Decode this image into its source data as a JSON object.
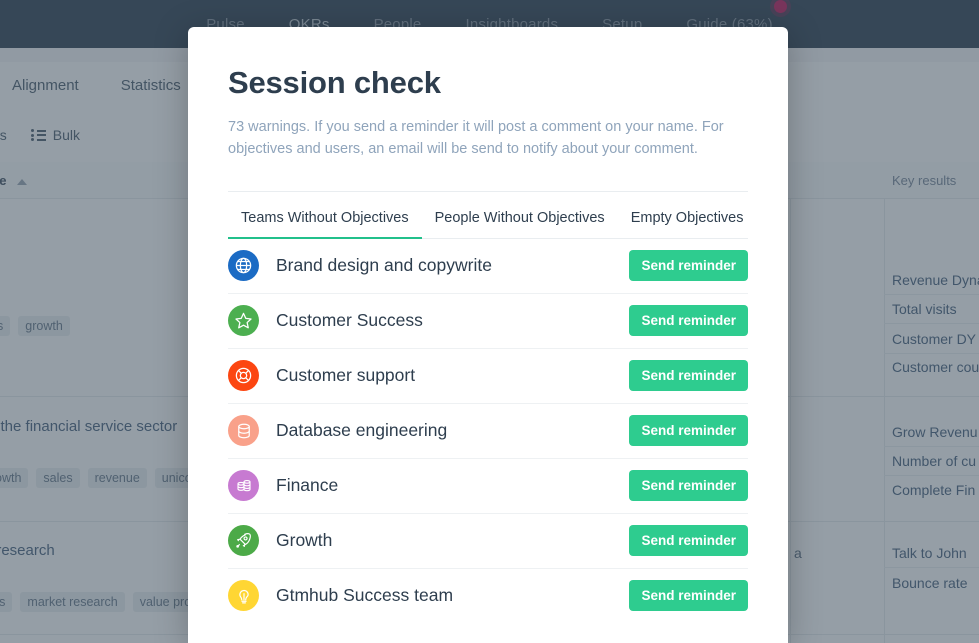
{
  "background": {
    "topnav": {
      "items": [
        {
          "label": "Pulse",
          "active": false,
          "badge": false
        },
        {
          "label": "OKRs",
          "active": true,
          "badge": false
        },
        {
          "label": "People",
          "active": false,
          "badge": false
        },
        {
          "label": "Insightboards",
          "active": false,
          "badge": false
        },
        {
          "label": "Setup",
          "active": false,
          "badge": false
        },
        {
          "label": "Guide (63%)",
          "active": false,
          "badge": true
        }
      ]
    },
    "subtabs": [
      "Alignment",
      "Statistics"
    ],
    "toolbar": {
      "partial_label": "us",
      "bulk_label": "Bulk"
    },
    "table": {
      "col_tree": "ee",
      "col_key_results": "Key results",
      "rows": [
        {
          "tags": [
            "s",
            "growth"
          ],
          "key_results": [
            "Revenue Dyna",
            "Total visits",
            "Customer DY",
            "Customer cou"
          ]
        },
        {
          "title": "n the financial service sector",
          "tags": [
            "owth",
            "sales",
            "revenue",
            "unicor"
          ],
          "key_results": [
            "Grow Revenu",
            "Number of cu",
            "Complete Fin"
          ]
        },
        {
          "title": "t research",
          "tags": [
            "rs",
            "market research",
            "value pro"
          ],
          "extra_cell": "a",
          "key_results": [
            "Talk to John",
            "Bounce rate"
          ]
        }
      ]
    }
  },
  "modal": {
    "title": "Session check",
    "description": "73 warnings. If you send a reminder it will post a comment on your name. For objectives and users, an email will be send to notify about your comment.",
    "tabs": [
      {
        "label": "Teams Without Objectives",
        "active": true
      },
      {
        "label": "People Without Objectives",
        "active": false
      },
      {
        "label": "Empty Objectives",
        "active": false
      }
    ],
    "button_label": "Send reminder",
    "rows": [
      {
        "label": "Brand design and copywrite",
        "icon": "globe-icon",
        "color": "#1b6bc4"
      },
      {
        "label": "Customer Success",
        "icon": "star-icon",
        "color": "#4caf50"
      },
      {
        "label": "Customer support",
        "icon": "life-ring-icon",
        "color": "#fc4611"
      },
      {
        "label": "Database engineering",
        "icon": "database-icon",
        "color": "#f9a18a"
      },
      {
        "label": "Finance",
        "icon": "money-stack-icon",
        "color": "#c77ad1"
      },
      {
        "label": "Growth",
        "icon": "rocket-icon",
        "color": "#4caa48"
      },
      {
        "label": "Gtmhub Success team",
        "icon": "lightbulb-icon",
        "color": "#ffd633"
      }
    ]
  },
  "colors": {
    "accent_green": "#2ecc8f",
    "tab_underline": "#21c08b",
    "navbar": "#2d3e50",
    "badge_red": "#c2185b",
    "title_text": "#2e3e4e"
  }
}
